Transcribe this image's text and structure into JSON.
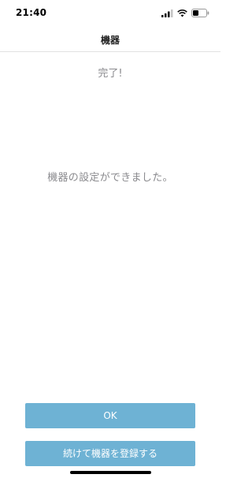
{
  "status_bar": {
    "time": "21:40",
    "icons": [
      "signal-icon",
      "wifi-icon",
      "battery-icon"
    ]
  },
  "header": {
    "title": "機器"
  },
  "main": {
    "complete_label": "完了!",
    "message": "機器の設定ができました。"
  },
  "actions": {
    "ok_label": "OK",
    "continue_label": "続けて機器を登録する"
  },
  "colors": {
    "button": "#6eb2d4",
    "text_muted": "#8a8a8e"
  }
}
